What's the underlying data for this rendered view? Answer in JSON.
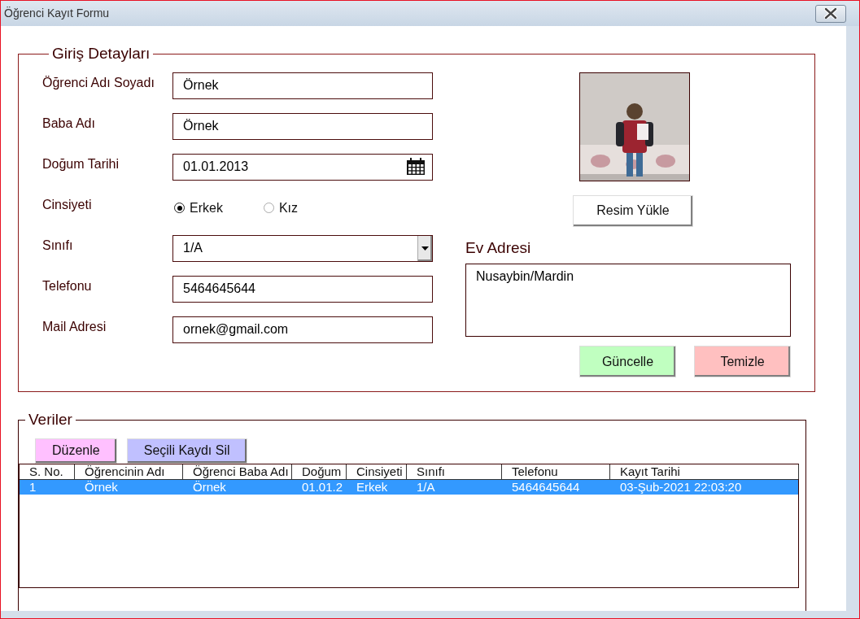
{
  "window": {
    "title": "Öğrenci Kayıt Formu"
  },
  "entry_details": {
    "title": "Giriş Detayları",
    "fields": [
      {
        "kind": "text",
        "label": "Öğrenci Adı Soyadı",
        "value": "Örnek"
      },
      {
        "kind": "text",
        "label": "Baba Adı",
        "value": "Örnek"
      },
      {
        "kind": "date",
        "label": "Doğum Tarihi",
        "value": "01.01.2013"
      },
      {
        "kind": "radio",
        "label": "Cinsiyeti",
        "options": [
          {
            "label": "Erkek",
            "selected": true
          },
          {
            "label": "Kız",
            "selected": false
          }
        ]
      },
      {
        "kind": "dropdown",
        "label": "Sınıfı",
        "value": "1/A"
      },
      {
        "kind": "text",
        "label": "Telefonu",
        "value": "5464645644"
      },
      {
        "kind": "text",
        "label": "Mail Adresi",
        "value": "ornek@gmail.com"
      }
    ],
    "upload_button": "Resim Yükle",
    "address": {
      "label": "Ev Adresi",
      "value": "Nusaybin/Mardin"
    },
    "buttons": [
      {
        "label": "Güncelle",
        "color": "#c0ffc0"
      },
      {
        "label": "Temizle",
        "color": "#ffc0c0"
      }
    ]
  },
  "records": {
    "title": "Veriler",
    "buttons": [
      {
        "label": "Düzenle",
        "color": "#ffc0ff"
      },
      {
        "label": "Seçili Kaydı Sil",
        "color": "#c0c0ff"
      }
    ],
    "table": {
      "columns": [
        "S. No.",
        "Öğrencinin Adı",
        "Öğrenci Baba Adı",
        "Doğum",
        "Cinsiyeti",
        "Sınıfı",
        "Telefonu",
        "Kayıt Tarihi"
      ],
      "rows": [
        {
          "selected": true,
          "cells": [
            "1",
            "Örnek",
            "Örnek",
            "01.01.2",
            "Erkek",
            "1/A",
            "5464645644",
            "03-Şub-2021 22:03:20"
          ]
        }
      ]
    }
  }
}
